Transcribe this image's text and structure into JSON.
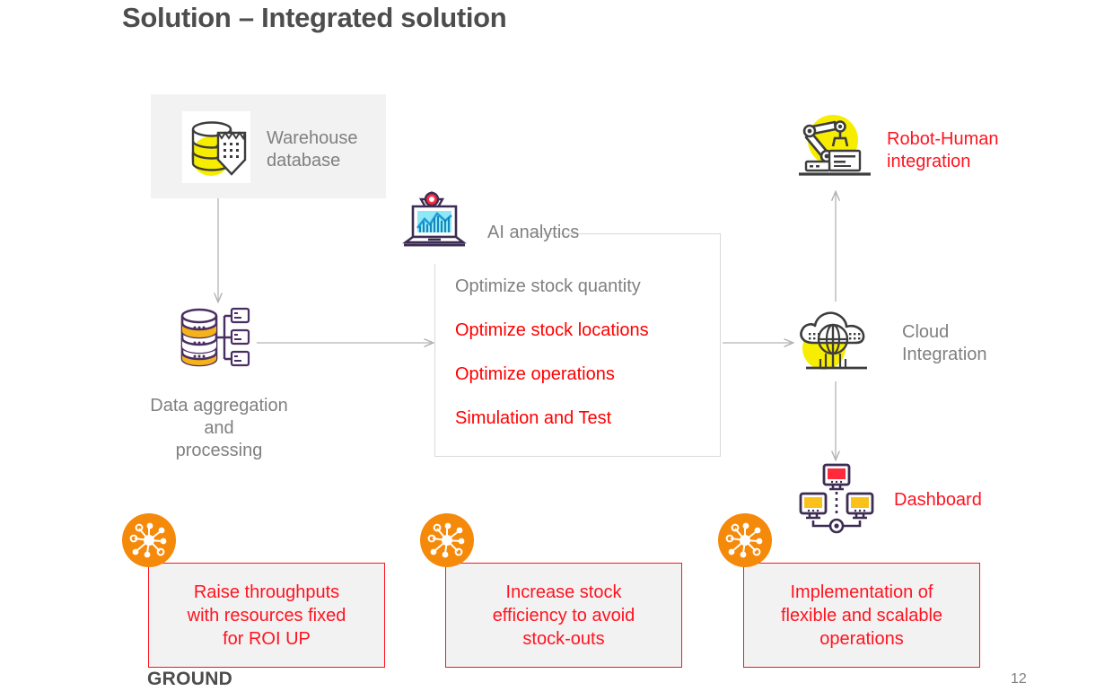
{
  "slide": {
    "title": "Solution – Integrated solution",
    "footer_logo": "GROUND",
    "page_number": "12",
    "colors": {
      "red": "#ff0000",
      "red_box": "#ff1420",
      "gray_text": "#808080",
      "title_gray": "#4d4d4d",
      "panel_gray": "#f2f2f2",
      "orange": "#f5890a",
      "yellow": "#f7ed00",
      "purple": "#3d2c52"
    }
  },
  "flow": {
    "warehouse": {
      "label": "Warehouse\ndatabase",
      "icon": "database-shield-icon"
    },
    "data_aggregation": {
      "label": "Data aggregation\nand\nprocessing",
      "icon": "database-servers-icon"
    },
    "ai_analytics": {
      "label": "AI analytics",
      "icon": "laptop-chart-gear-icon",
      "items": [
        {
          "text": "Optimize stock quantity",
          "color": "gray"
        },
        {
          "text": "Optimize stock locations",
          "color": "red"
        },
        {
          "text": "Optimize operations",
          "color": "red"
        },
        {
          "text": "Simulation and Test",
          "color": "red"
        }
      ]
    },
    "robot_human": {
      "label": "Robot-Human\nintegration",
      "icon": "robot-arm-icon"
    },
    "cloud_integration": {
      "label": "Cloud\nIntegration",
      "icon": "cloud-globe-icon"
    },
    "dashboard": {
      "label": "Dashboard",
      "icon": "monitors-network-icon"
    }
  },
  "benefits": [
    {
      "text": "Raise throughputs\nwith resources fixed\nfor ROI UP",
      "icon": "network-nodes-icon"
    },
    {
      "text": "Increase stock\nefficiency to avoid\nstock-outs",
      "icon": "network-nodes-icon"
    },
    {
      "text": "Implementation of\nflexible and scalable\noperations",
      "icon": "network-nodes-icon"
    }
  ]
}
